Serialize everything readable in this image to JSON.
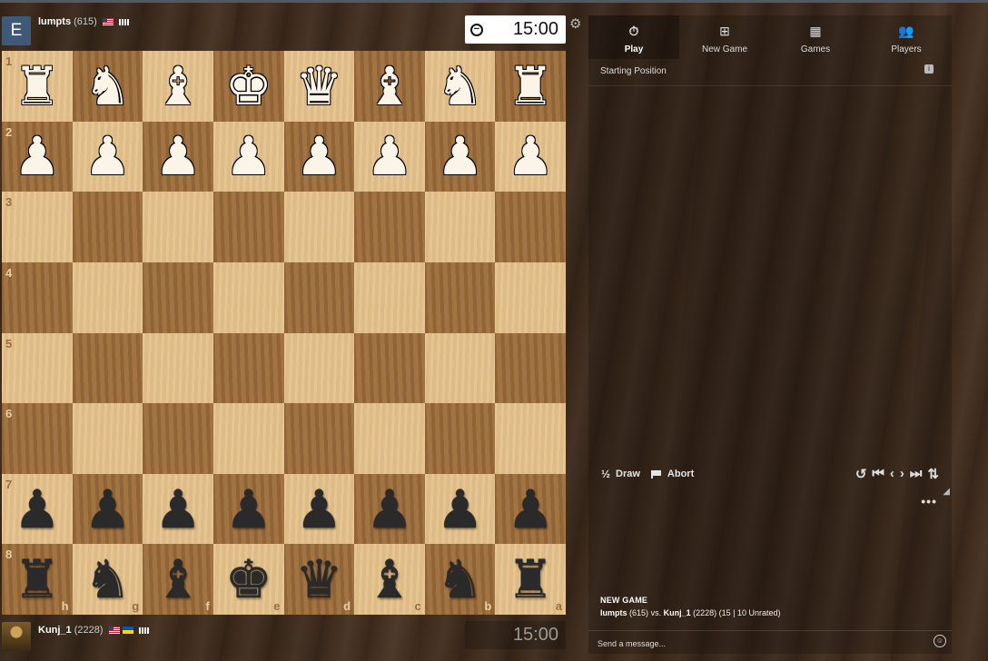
{
  "top_player": {
    "avatar_letter": "E",
    "name": "lumpts",
    "rating": "(615)",
    "clock": "15:00"
  },
  "bottom_player": {
    "name": "Kunj_1",
    "rating": "(2228)",
    "clock": "15:00"
  },
  "board": {
    "ranks": [
      "1",
      "2",
      "3",
      "4",
      "5",
      "6",
      "7",
      "8"
    ],
    "files": [
      "h",
      "g",
      "f",
      "e",
      "d",
      "c",
      "b",
      "a"
    ],
    "top_back_row": [
      "♜",
      "♞",
      "♝",
      "♚",
      "♛",
      "♝",
      "♞",
      "♜"
    ],
    "top_pawn": "♟",
    "bottom_pawn": "♟",
    "bottom_back_row": [
      "♜",
      "♞",
      "♝",
      "♚",
      "♛",
      "♝",
      "♞",
      "♜"
    ]
  },
  "tabs": [
    {
      "label": "Play",
      "icon": "stopwatch-icon",
      "active": true
    },
    {
      "label": "New Game",
      "icon": "plus-square-icon",
      "active": false
    },
    {
      "label": "Games",
      "icon": "board-grid-icon",
      "active": false
    },
    {
      "label": "Players",
      "icon": "users-icon",
      "active": false
    }
  ],
  "panel": {
    "status": "Starting Position",
    "draw_label": "Draw",
    "draw_symbol": "½",
    "abort_label": "Abort",
    "new_game_title": "NEW GAME",
    "game_white": "lumpts",
    "game_white_rating": "(615)",
    "game_vs": "vs.",
    "game_black": "Kunj_1",
    "game_black_rating": "(2228)",
    "game_meta": "(15 | 10 Unrated)",
    "message_placeholder": "Send a message..."
  },
  "colors": {
    "light_square": "#e3c08a",
    "dark_square": "#9c6d3c"
  }
}
